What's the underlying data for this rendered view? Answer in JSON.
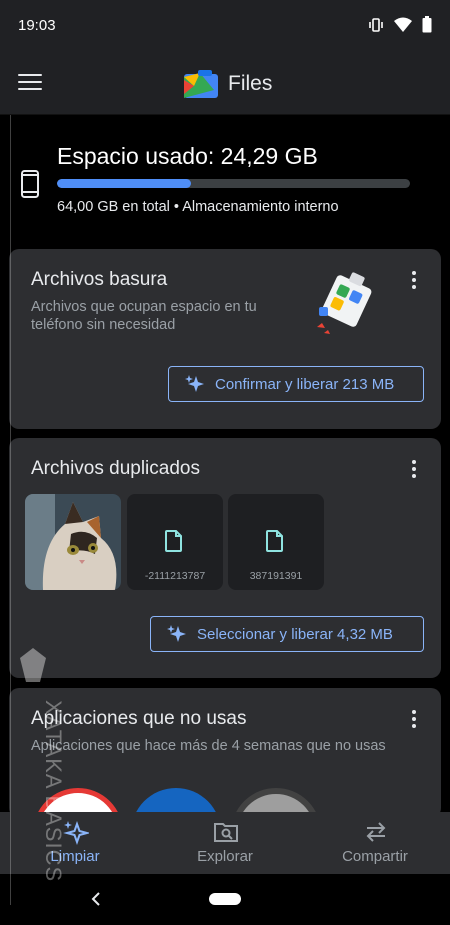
{
  "status_bar": {
    "time": "19:03",
    "icons": [
      "vibrate-icon",
      "wifi-icon",
      "battery-icon"
    ]
  },
  "app_bar": {
    "title": "Files"
  },
  "storage": {
    "title": "Espacio usado: 24,29 GB",
    "subtitle": "64,00 GB en total • Almacenamiento interno",
    "used_fraction": 0.38
  },
  "cards": {
    "junk": {
      "title": "Archivos basura",
      "description": "Archivos que ocupan espacio en tu teléfono sin necesidad",
      "button_label": "Confirmar y liberar 213 MB"
    },
    "duplicates": {
      "title": "Archivos duplicados",
      "thumbs": [
        "-2111213787",
        "387191391"
      ],
      "button_label": "Seleccionar y liberar 4,32 MB"
    },
    "unused_apps": {
      "title": "Aplicaciones que no usas",
      "description": "Aplicaciones que hace más de 4 semanas que no usas"
    }
  },
  "bottom_nav": [
    {
      "label": "Limpiar",
      "icon": "sparkle-icon",
      "active": true
    },
    {
      "label": "Explorar",
      "icon": "folder-search-icon",
      "active": false
    },
    {
      "label": "Compartir",
      "icon": "swap-arrows-icon",
      "active": false
    }
  ],
  "watermark": {
    "text": "XATAKA BASICS"
  },
  "colors": {
    "accent": "#8ab4f8",
    "bar_fill": "#4f8ef7",
    "card_bg": "#2d2e31",
    "appbar_bg": "#202124"
  }
}
